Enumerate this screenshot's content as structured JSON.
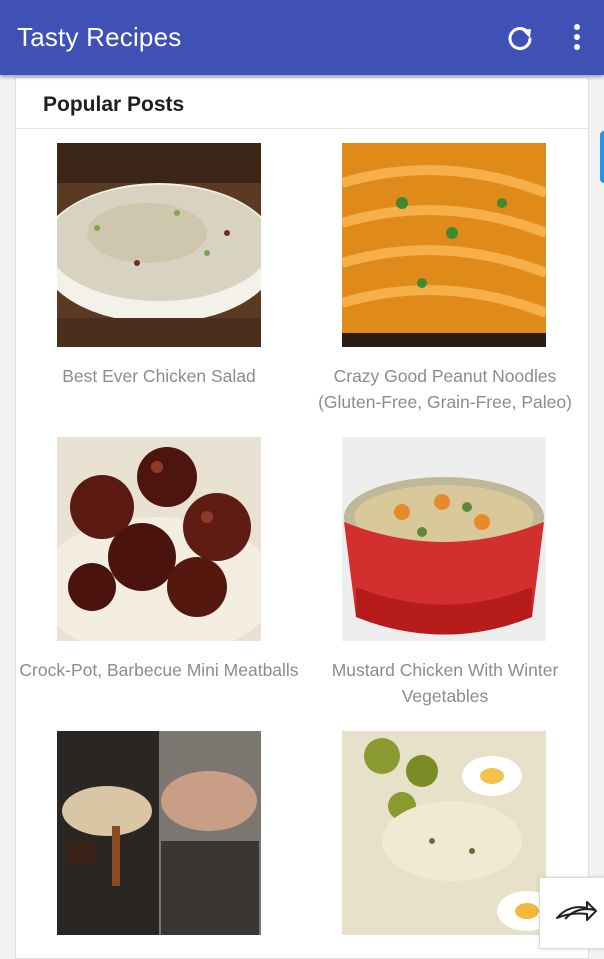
{
  "appbar": {
    "title": "Tasty Recipes",
    "icons": [
      "refresh-icon",
      "more-vert-icon"
    ],
    "color": "#3f51b5"
  },
  "section": {
    "title": "Popular Posts"
  },
  "posts": [
    {
      "title": "Best Ever Chicken Salad",
      "image": "chicken-salad-photo"
    },
    {
      "title": "Crazy Good Peanut Noodles (Gluten-Free, Grain-Free, Paleo)",
      "image": "peanut-noodles-photo"
    },
    {
      "title": "Crock-Pot, Barbecue Mini Meatballs",
      "image": "meatballs-photo"
    },
    {
      "title": "Mustard Chicken With Winter Vegetables",
      "image": "mustard-chicken-photo"
    },
    {
      "title": "",
      "image": "slow-cooker-cocoa-photo"
    },
    {
      "title": "",
      "image": "potato-salad-photo"
    }
  ],
  "fab": {
    "icon": "share-arrow-icon"
  }
}
